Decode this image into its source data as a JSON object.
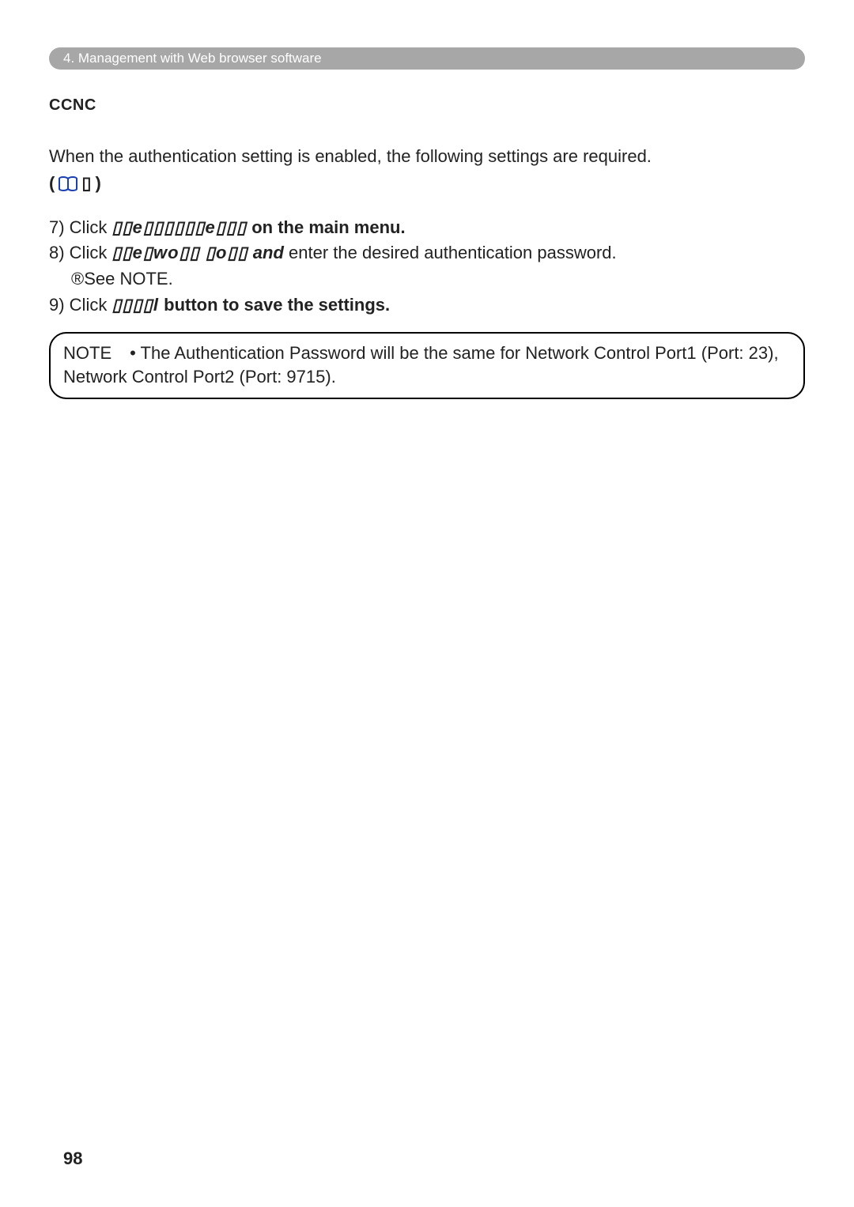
{
  "header": {
    "breadcrumb": "4. Management with Web browser software"
  },
  "section": {
    "title": "CCNC"
  },
  "intro": {
    "line1": "When the authentication setting is enabled, the following settings are required.",
    "book_open": "(",
    "book_close": ")",
    "book_garble": "▯"
  },
  "steps": {
    "s7": {
      "prefix": "7) Click ",
      "garble1": "▯▯e▯▯▯▯▯▯e▯▯▯",
      "bold1": "on the main menu."
    },
    "s8": {
      "prefix": "8) Click ",
      "garble1": "▯▯e▯wo▯▯ ▯o▯▯",
      "mid": "and",
      "rest": " enter the desired authentication password.",
      "see": "®See NOTE."
    },
    "s9": {
      "prefix": "9) Click ",
      "garble1": "▯▯▯▯l",
      "bold1": "button to save the settings."
    }
  },
  "note": {
    "label": "NOTE",
    "bullet": "• The Authentication Password will be the same for Network Control Port1 (Port: 23), Network Control Port2 (Port: 9715)."
  },
  "page_number": "98"
}
